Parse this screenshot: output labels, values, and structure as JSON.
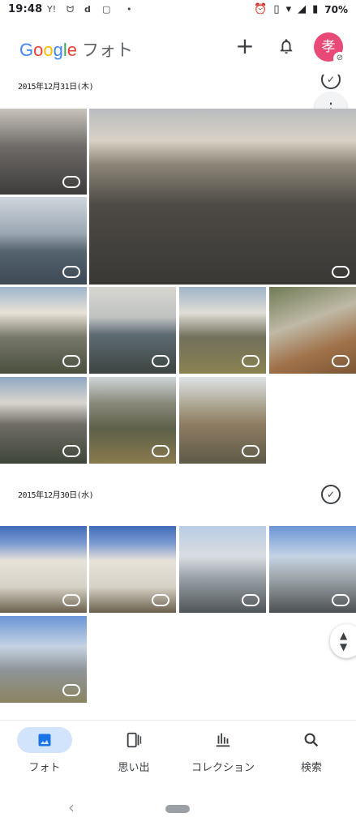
{
  "status_bar": {
    "time": "19:48",
    "battery": "70%"
  },
  "app_bar": {
    "logo_google": "Google",
    "logo_photos": "フォト",
    "avatar_letter": "孝"
  },
  "sections": [
    {
      "date": "2015年12月31日(木)"
    },
    {
      "date": "2015年12月30日(水)"
    }
  ],
  "bottom_nav": [
    {
      "label": "フォト",
      "icon": "photo-icon",
      "active": true
    },
    {
      "label": "思い出",
      "icon": "memories-icon",
      "active": false
    },
    {
      "label": "コレクション",
      "icon": "collections-icon",
      "active": false
    },
    {
      "label": "検索",
      "icon": "search-icon",
      "active": false
    }
  ],
  "colors": {
    "accent": "#d2e3fc",
    "avatar": "#e84976",
    "brand_blue": "#4285F4"
  }
}
